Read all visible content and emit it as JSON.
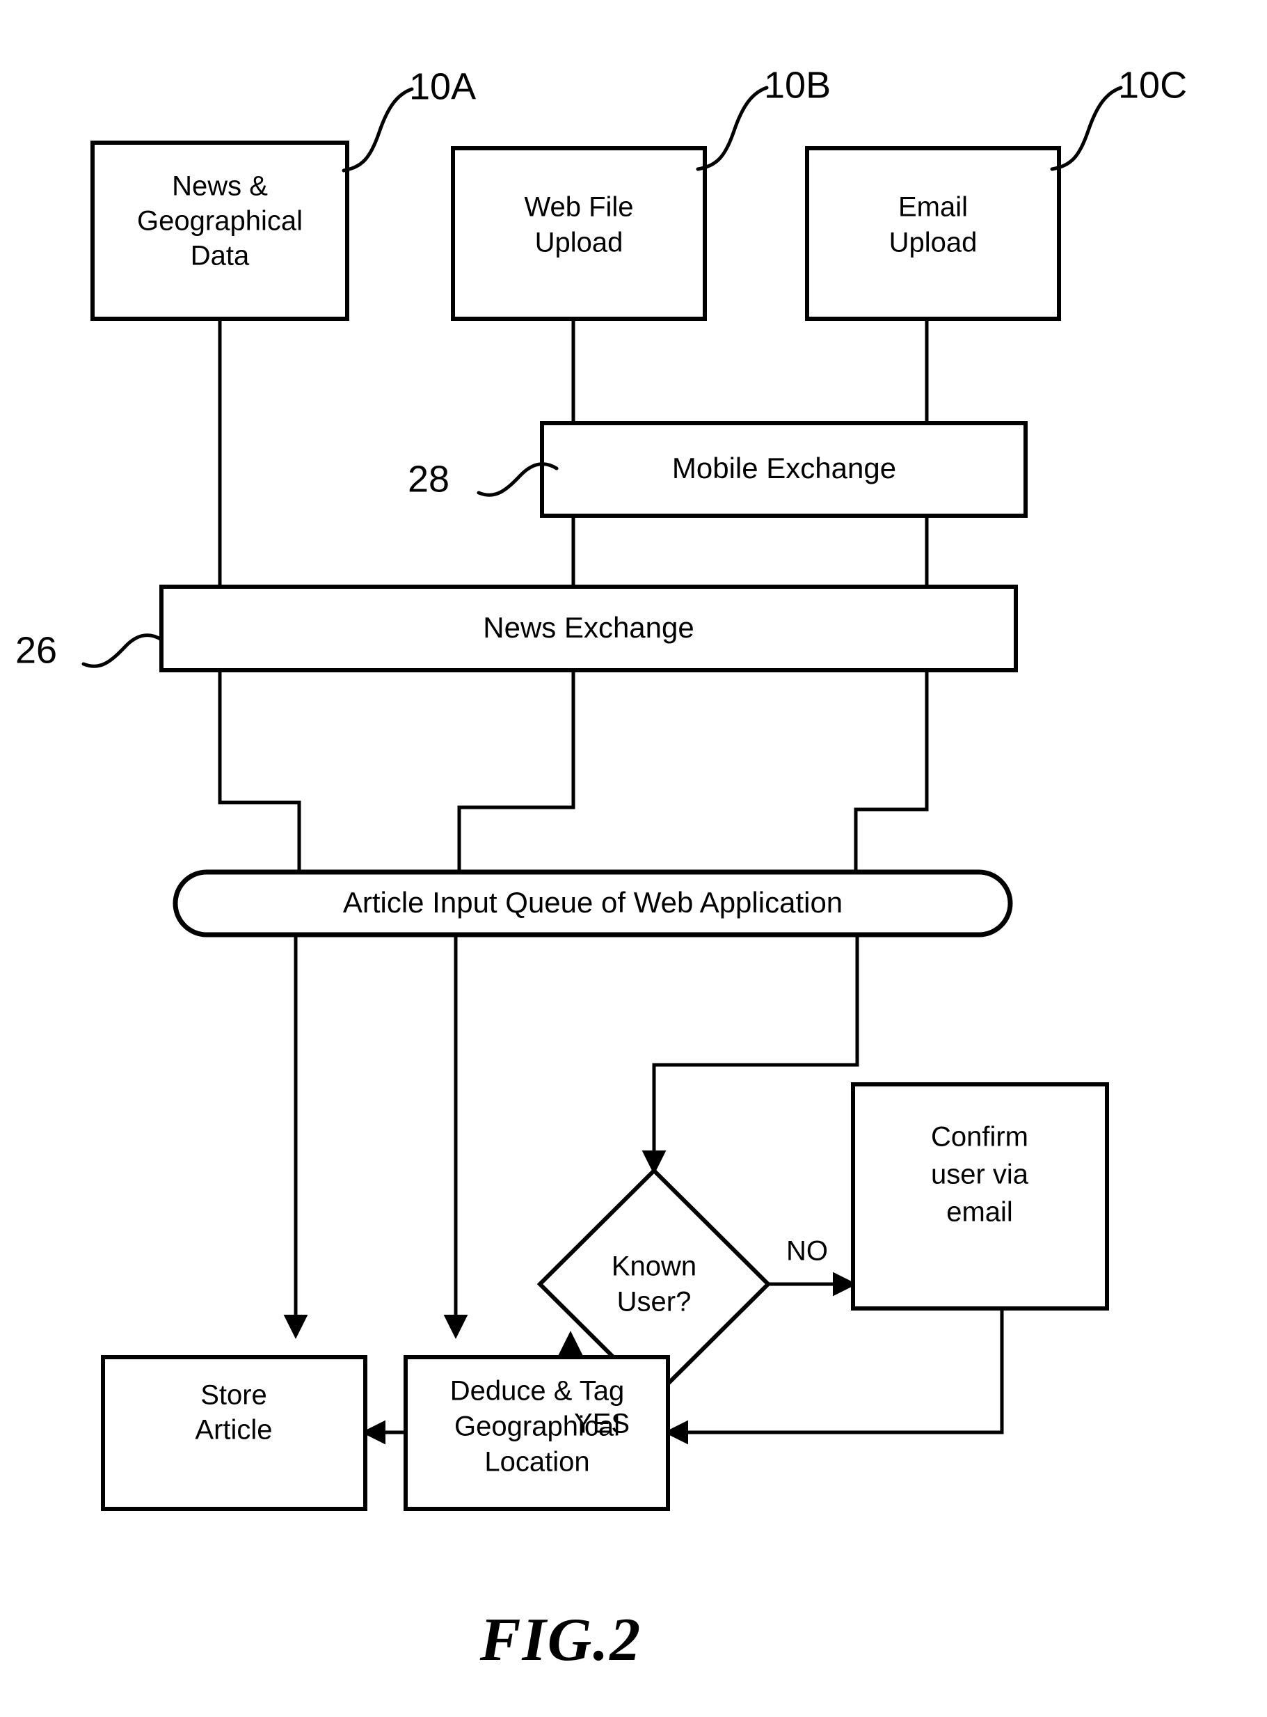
{
  "figure": {
    "caption": "FIG.2",
    "title": "FIG.2"
  },
  "reference_numerals": [
    {
      "id": "ref-10a",
      "text": "10A",
      "points_to": "News & Geographical Data"
    },
    {
      "id": "ref-10b",
      "text": "10B",
      "points_to": "Web File Upload"
    },
    {
      "id": "ref-10c",
      "text": "10C",
      "points_to": "Email Upload"
    },
    {
      "id": "ref-28",
      "text": "28",
      "points_to": "Mobile Exchange"
    },
    {
      "id": "ref-26",
      "text": "26",
      "points_to": "News Exchange"
    }
  ],
  "nodes": {
    "news_geo_data": {
      "lines": [
        "News &",
        "Geographical",
        "Data"
      ],
      "shape": "rectangle"
    },
    "web_file_upload": {
      "lines": [
        "Web File",
        "Upload"
      ],
      "shape": "rectangle"
    },
    "email_upload": {
      "lines": [
        "Email",
        "Upload"
      ],
      "shape": "rectangle"
    },
    "mobile_exchange": {
      "lines": [
        "Mobile Exchange"
      ],
      "shape": "rectangle"
    },
    "news_exchange": {
      "lines": [
        "News Exchange"
      ],
      "shape": "rectangle"
    },
    "article_input_queue": {
      "lines": [
        "Article Input Queue of Web Application"
      ],
      "shape": "stadium"
    },
    "known_user": {
      "lines": [
        "Known",
        "User?"
      ],
      "shape": "diamond"
    },
    "confirm_user": {
      "lines": [
        "Confirm",
        "user via",
        "email"
      ],
      "shape": "rectangle"
    },
    "store_article": {
      "lines": [
        "Store",
        "Article"
      ],
      "shape": "rectangle"
    },
    "deduce_tag": {
      "lines": [
        "Deduce & Tag",
        "Geographical",
        "Location"
      ],
      "shape": "rectangle"
    }
  },
  "edge_labels": {
    "no": "NO",
    "yes": "YES"
  },
  "colors": {
    "ink": "#000000",
    "paper": "#ffffff"
  }
}
